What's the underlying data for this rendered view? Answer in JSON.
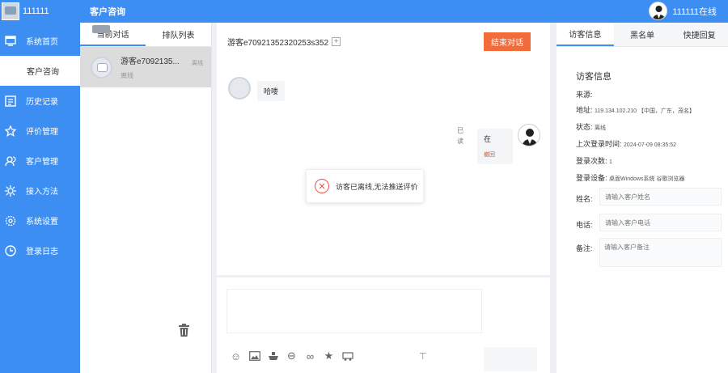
{
  "sidebar": {
    "user": "111111",
    "items": [
      {
        "label": "系统首页",
        "icon": "monitor-icon"
      },
      {
        "label": "客户咨询",
        "icon": "",
        "active": true
      },
      {
        "label": "历史记录",
        "icon": "history-icon"
      },
      {
        "label": "评价管理",
        "icon": "star-icon"
      },
      {
        "label": "客户管理",
        "icon": "users-icon"
      },
      {
        "label": "接入方法",
        "icon": "gear-plug-icon"
      },
      {
        "label": "系统设置",
        "icon": "settings-icon"
      },
      {
        "label": "登录日志",
        "icon": "clock-icon"
      }
    ]
  },
  "topbar": {
    "title": "客户咨询",
    "status": "111111在线"
  },
  "convlist": {
    "tabs": [
      "当前对话",
      "排队列表"
    ],
    "items": [
      {
        "name": "游客e7092135...",
        "status": "离线",
        "time": "离线"
      }
    ]
  },
  "chat": {
    "visitor_id": "游客e70921352320253s352",
    "end_button": "结束对话",
    "time1": "",
    "time2": "",
    "visitor_msg": "哈喽",
    "read_status": "已读",
    "agent_msg": "在",
    "recall": "撤回",
    "toast": "访客已离线,无法推送评价"
  },
  "rpanel": {
    "tabs": [
      "访客信息",
      "黑名单",
      "快捷回复"
    ],
    "section_title": "访客信息",
    "source_label": "来源:",
    "address_label": "地址:",
    "address_value": "119.134.102.210 【中国，广东，茂名】",
    "state_label": "状态:",
    "state_value": "离线",
    "last_login_label": "上次登录时间:",
    "last_login_value": "2024-07-09 08:35:52",
    "login_count_label": "登录次数:",
    "login_count_value": "1",
    "device_label": "登录设备:",
    "device_value": "桌面Windows系统 谷歌浏览器",
    "name_label": "姓名:",
    "name_placeholder": "请输入客户姓名",
    "phone_label": "电话:",
    "phone_placeholder": "请输入客户电话",
    "note_label": "备注:",
    "note_placeholder": "请输入客户备注"
  }
}
